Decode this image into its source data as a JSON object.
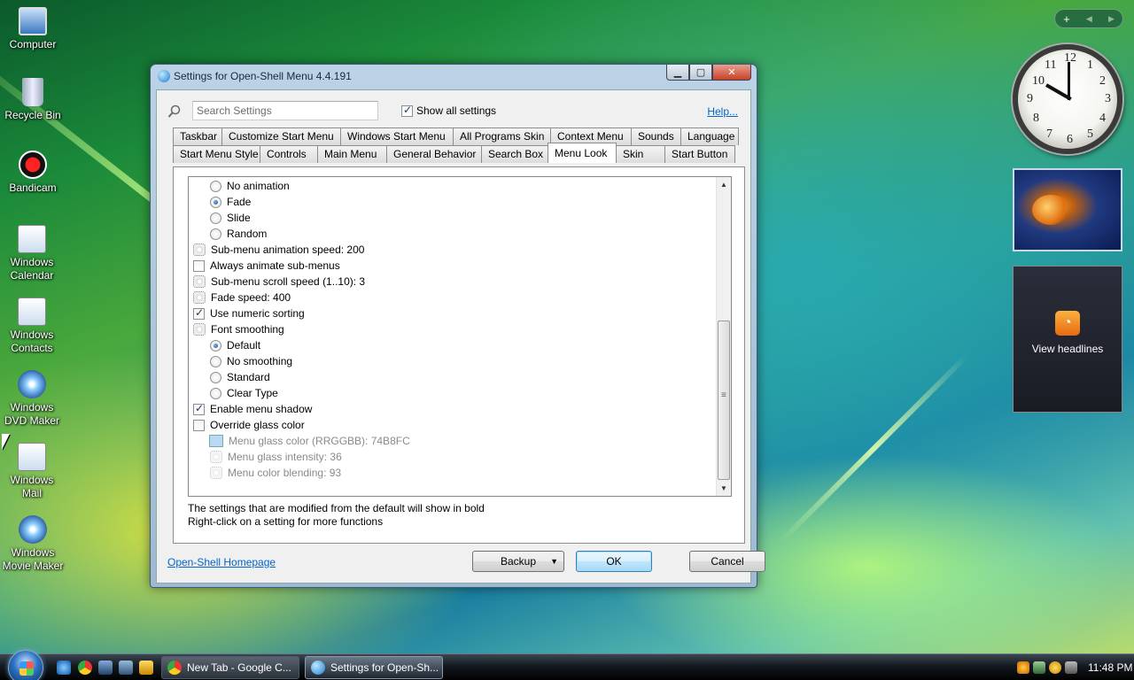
{
  "desktop": {
    "icons": [
      {
        "label": "Computer"
      },
      {
        "label": "Recycle Bin"
      },
      {
        "label": "Bandicam"
      },
      {
        "label": "Windows Calendar"
      },
      {
        "label": "Windows Contacts"
      },
      {
        "label": "Windows DVD Maker"
      },
      {
        "label": "Windows Mail"
      },
      {
        "label": "Windows Movie Maker"
      }
    ]
  },
  "gadgets": {
    "add_label": "+",
    "clock_numbers": [
      "12",
      "1",
      "2",
      "3",
      "4",
      "5",
      "6",
      "7",
      "8",
      "9",
      "10",
      "11"
    ],
    "feed_label": "View headlines"
  },
  "window": {
    "title": "Settings for Open-Shell Menu 4.4.191",
    "search_placeholder": "Search Settings",
    "show_all_label": "Show all settings",
    "help_label": "Help...",
    "tabs_row1": [
      "Taskbar",
      "Customize Start Menu",
      "Windows Start Menu",
      "All Programs Skin",
      "Context Menu",
      "Sounds",
      "Language"
    ],
    "tabs_row2": [
      "Start Menu Style",
      "Controls",
      "Main Menu",
      "General Behavior",
      "Search Box",
      "Menu Look",
      "Skin",
      "Start Button"
    ],
    "active_tab": "Menu Look",
    "settings": [
      {
        "type": "radio",
        "checked": false,
        "indent": 1,
        "label": "No animation",
        "disabled": false
      },
      {
        "type": "radio",
        "checked": true,
        "indent": 1,
        "label": "Fade",
        "disabled": false
      },
      {
        "type": "radio",
        "checked": false,
        "indent": 1,
        "label": "Slide",
        "disabled": false
      },
      {
        "type": "radio",
        "checked": false,
        "indent": 1,
        "label": "Random",
        "disabled": false
      },
      {
        "type": "gear",
        "indent": 0,
        "label": "Sub-menu animation speed: 200",
        "disabled": false
      },
      {
        "type": "check",
        "checked": false,
        "indent": 0,
        "label": "Always animate sub-menus",
        "disabled": false
      },
      {
        "type": "gear",
        "indent": 0,
        "label": "Sub-menu scroll speed (1..10): 3",
        "disabled": false
      },
      {
        "type": "gear",
        "indent": 0,
        "label": "Fade speed: 400",
        "disabled": false
      },
      {
        "type": "check",
        "checked": true,
        "indent": 0,
        "label": "Use numeric sorting",
        "disabled": false
      },
      {
        "type": "gear",
        "indent": 0,
        "label": "Font smoothing",
        "disabled": false
      },
      {
        "type": "radio",
        "checked": true,
        "indent": 1,
        "label": "Default",
        "disabled": false
      },
      {
        "type": "radio",
        "checked": false,
        "indent": 1,
        "label": "No smoothing",
        "disabled": false
      },
      {
        "type": "radio",
        "checked": false,
        "indent": 1,
        "label": "Standard",
        "disabled": false
      },
      {
        "type": "radio",
        "checked": false,
        "indent": 1,
        "label": "Clear Type",
        "disabled": false
      },
      {
        "type": "check",
        "checked": true,
        "indent": 0,
        "label": "Enable menu shadow",
        "disabled": false
      },
      {
        "type": "check",
        "checked": false,
        "indent": 0,
        "label": "Override glass color",
        "disabled": false
      },
      {
        "type": "swatch",
        "indent": 1,
        "label": "Menu glass color (RRGGBB): 74B8FC",
        "disabled": true,
        "color": "#74B8FC"
      },
      {
        "type": "gear",
        "indent": 1,
        "label": "Menu glass intensity: 36",
        "disabled": true
      },
      {
        "type": "gear",
        "indent": 1,
        "label": "Menu color blending: 93",
        "disabled": true
      }
    ],
    "info_line1": "The settings that are modified from the default will show in bold",
    "info_line2": "Right-click on a setting for more functions",
    "homepage_link": "Open-Shell Homepage",
    "backup_label": "Backup",
    "ok_label": "OK",
    "cancel_label": "Cancel"
  },
  "taskbar": {
    "buttons": [
      {
        "label": "New Tab - Google C...",
        "active": false
      },
      {
        "label": "Settings for Open-Sh...",
        "active": true
      }
    ],
    "time": "11:48 PM"
  }
}
